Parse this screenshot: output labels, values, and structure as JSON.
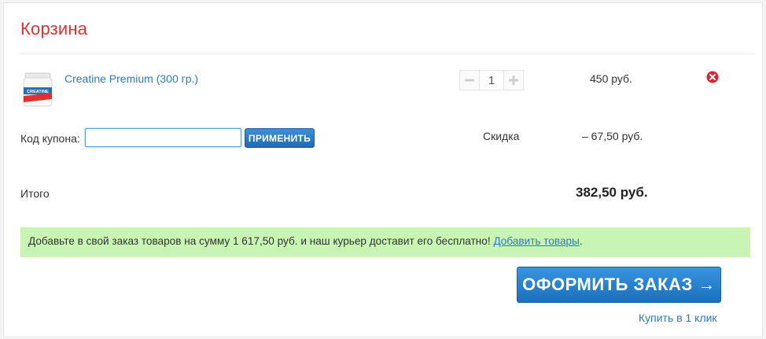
{
  "cart": {
    "title": "Корзина",
    "item": {
      "name": "Creatine Premium (300 гр.)",
      "quantity": "1",
      "price": "450 руб.",
      "thumb_text": "CREATINE"
    },
    "coupon": {
      "label": "Код купона:",
      "value": "",
      "apply_label": "ПРИМЕНИТЬ"
    },
    "discount": {
      "label": "Скидка",
      "value": "– 67,50 руб."
    },
    "total": {
      "label": "Итого",
      "value": "382,50 руб."
    },
    "notice": {
      "text": "Добавьте в свой заказ товаров на сумму 1 617,50 руб. и наш курьер доставит его бесплатно!",
      "link": "Добавить товары",
      "suffix": "."
    },
    "checkout_label": "ОФОРМИТЬ ЗАКАЗ →",
    "one_click_label": "Купить в 1 клик"
  },
  "icons": {
    "minus": "minus-icon",
    "plus": "plus-icon",
    "remove": "remove-icon"
  },
  "colors": {
    "title": "#e03131",
    "link": "#2f78c4",
    "button": "#1f6bb3",
    "notice_bg": "#c8f5b4",
    "remove": "#d9262e"
  }
}
